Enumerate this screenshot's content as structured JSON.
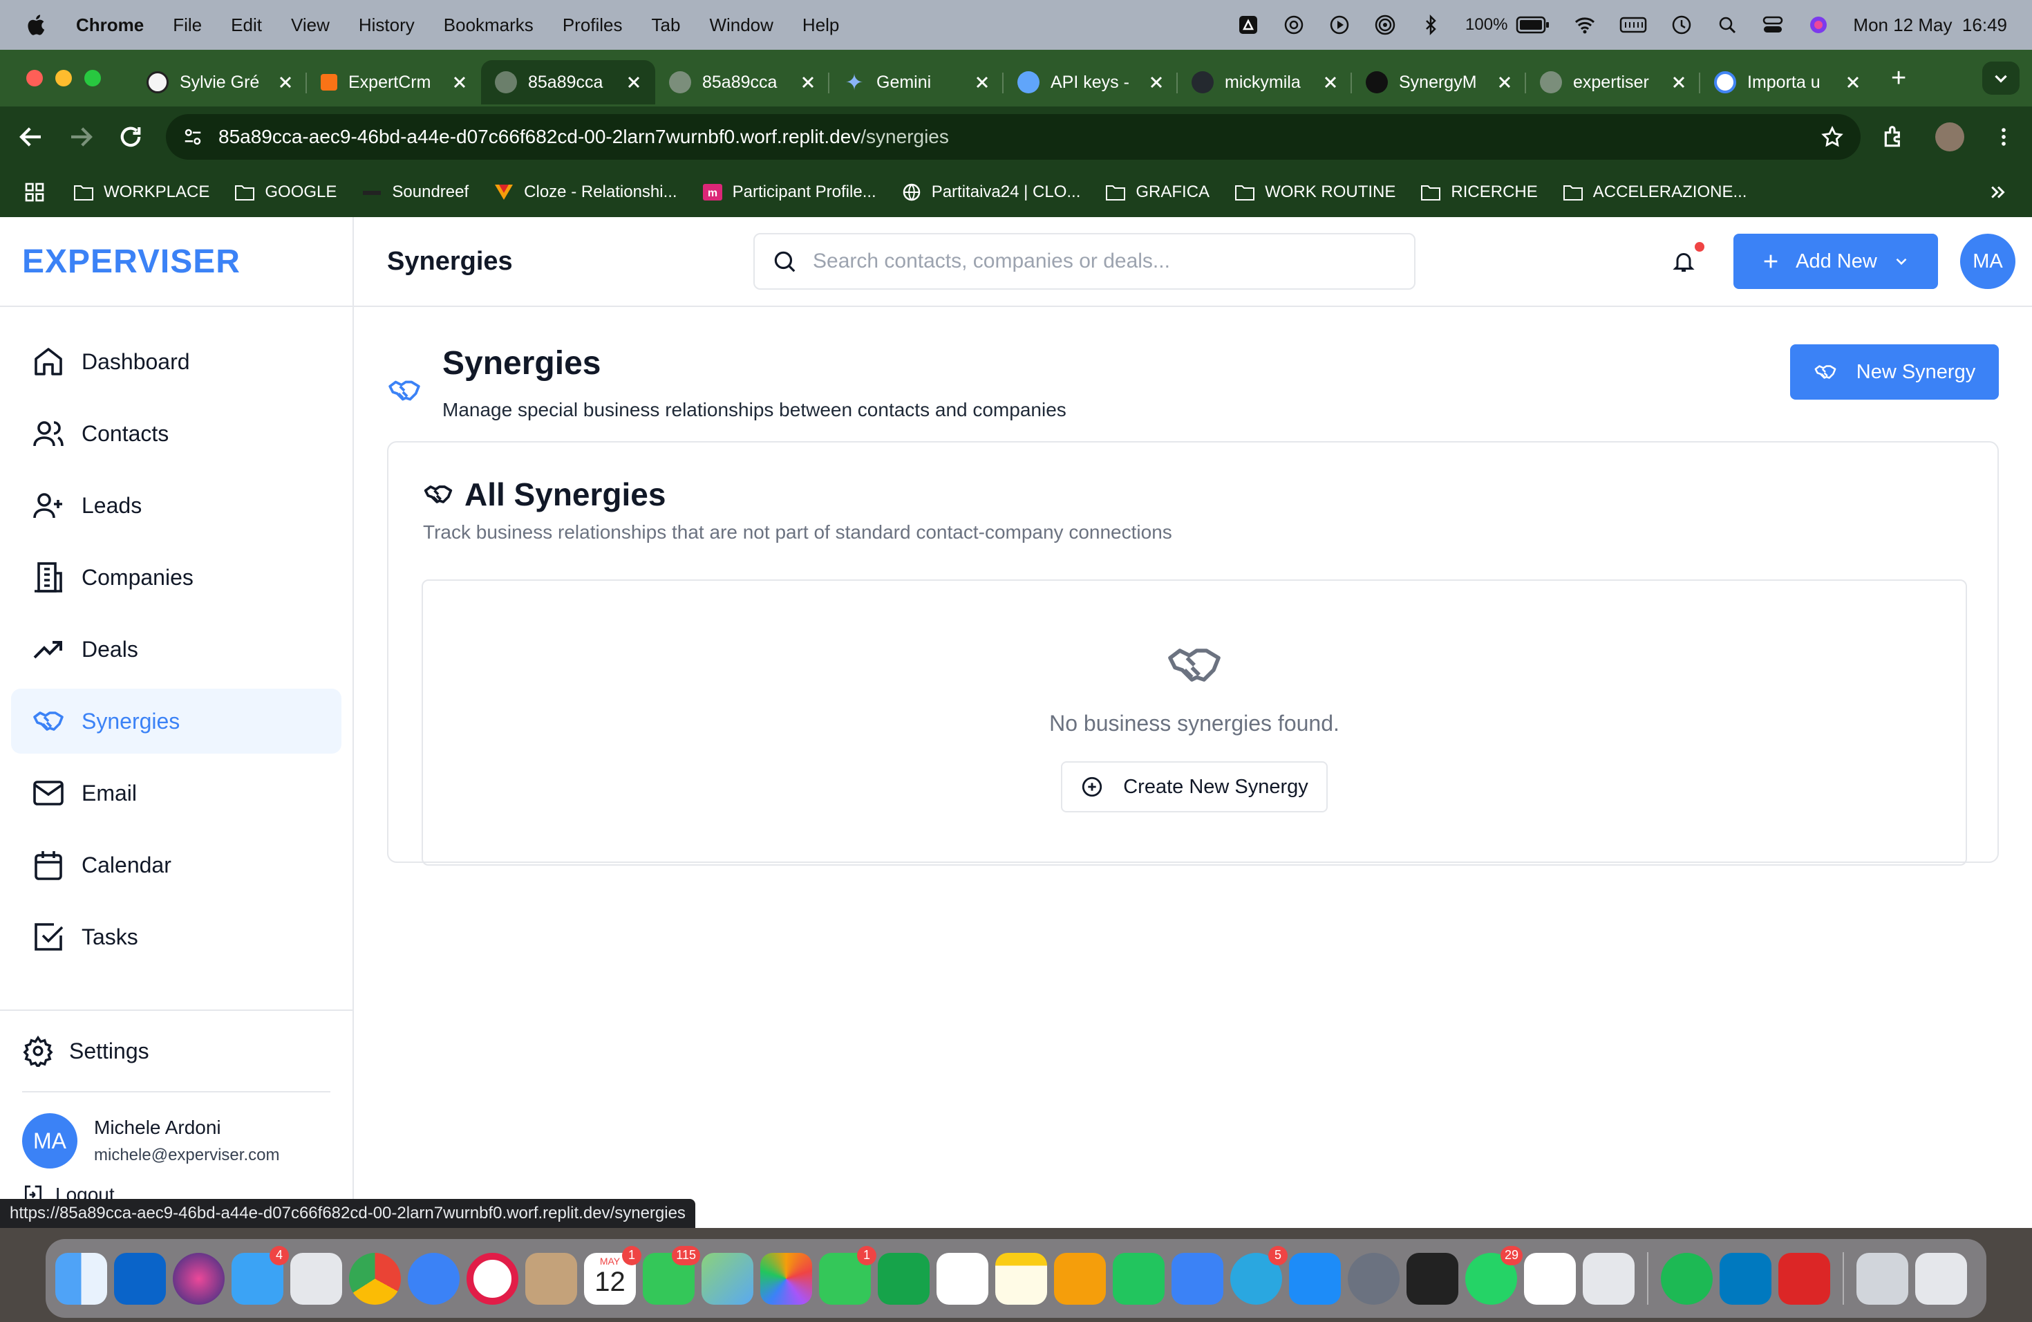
{
  "menubar": {
    "app": "Chrome",
    "items": [
      "File",
      "Edit",
      "View",
      "History",
      "Bookmarks",
      "Profiles",
      "Tab",
      "Window",
      "Help"
    ],
    "battery": "100%",
    "datetime": "Mon 12 May  16:49"
  },
  "tabs": [
    {
      "label": "Sylvie Gré",
      "active": false
    },
    {
      "label": "ExpertCrm",
      "active": false
    },
    {
      "label": "85a89cca",
      "active": true
    },
    {
      "label": "85a89cca",
      "active": false
    },
    {
      "label": "Gemini",
      "active": false
    },
    {
      "label": "API keys -",
      "active": false
    },
    {
      "label": "mickymila",
      "active": false
    },
    {
      "label": "SynergyM",
      "active": false
    },
    {
      "label": "expertiser",
      "active": false
    },
    {
      "label": "Importa u",
      "active": false
    }
  ],
  "address": {
    "host": "85a89cca-aec9-46bd-a44e-d07c66f682cd-00-2larn7wurnbf0.worf.replit.dev",
    "path": "/synergies"
  },
  "bookmarks": [
    "WORKPLACE",
    "GOOGLE",
    "Soundreef",
    "Cloze - Relationshi...",
    "Participant Profile...",
    "Partitaiva24 | CLO...",
    "GRAFICA",
    "WORK ROUTINE",
    "RICERCHE",
    "ACCELERAZIONE..."
  ],
  "brand": "EXPERVISER",
  "header": {
    "title": "Synergies",
    "search_placeholder": "Search contacts, companies or deals...",
    "add_new": "Add New",
    "avatar": "MA"
  },
  "nav": [
    {
      "label": "Dashboard",
      "icon": "home-icon"
    },
    {
      "label": "Contacts",
      "icon": "users-icon"
    },
    {
      "label": "Leads",
      "icon": "user-plus-icon"
    },
    {
      "label": "Companies",
      "icon": "building-icon"
    },
    {
      "label": "Deals",
      "icon": "trending-up-icon"
    },
    {
      "label": "Synergies",
      "icon": "handshake-icon",
      "active": true
    },
    {
      "label": "Email",
      "icon": "mail-icon"
    },
    {
      "label": "Calendar",
      "icon": "calendar-icon"
    },
    {
      "label": "Tasks",
      "icon": "check-square-icon"
    }
  ],
  "settings": "Settings",
  "user": {
    "initials": "MA",
    "name": "Michele Ardoni",
    "email": "michele@experviser.com",
    "logout": "Logout"
  },
  "page": {
    "title": "Synergies",
    "subtitle": "Manage special business relationships between contacts and companies",
    "new_button": "New Synergy"
  },
  "card": {
    "title": "All Synergies",
    "subtitle": "Track business relationships that are not part of standard contact-company connections",
    "empty_text": "No business synergies found.",
    "empty_button": "Create New Synergy"
  },
  "status_url": "https://85a89cca-aec9-46bd-a44e-d07c66f682cd-00-2larn7wurnbf0.worf.replit.dev/synergies",
  "dock": {
    "badges": {
      "mail": "4",
      "calendar": "1",
      "messages": "115",
      "facetime": "1",
      "telegram": "5",
      "whatsapp": "29"
    },
    "calendar_month": "MAY",
    "calendar_day": "12"
  },
  "colors": {
    "accent": "#3b82f6",
    "active_bg": "#eff6ff",
    "notification": "#ef4444",
    "chrome_frame": "#1c3f1c"
  }
}
